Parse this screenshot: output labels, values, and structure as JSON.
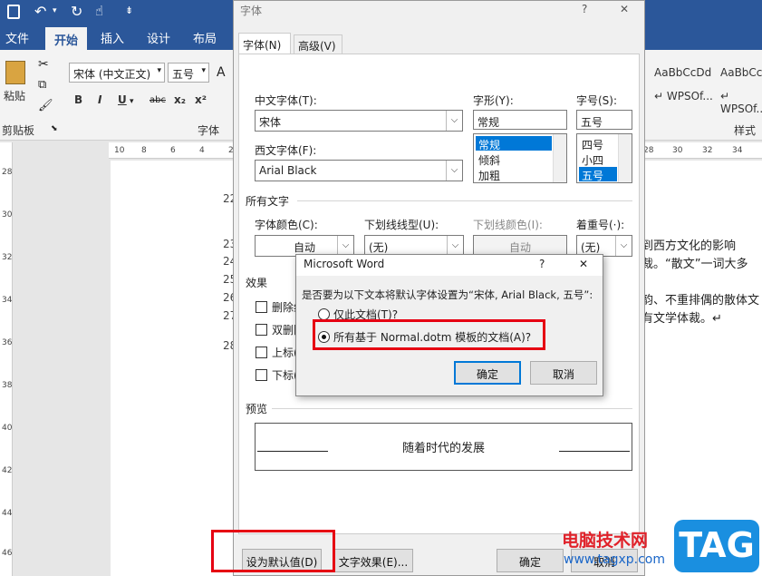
{
  "ribbon": {
    "tabs": [
      "文件",
      "开始",
      "插入",
      "设计",
      "布局"
    ],
    "active_tab": "开始",
    "paste_label": "粘贴",
    "clipboard_label": "剪贴板",
    "font_group_label": "字体",
    "styles_group_label": "样式",
    "font_name": "宋体 (中文正文)",
    "font_size": "五号",
    "style1_sample": "AaBbCcDd",
    "style1_name": "↵ WPSOf...",
    "style2_sample": "AaBbCcDd",
    "style2_name": "↵ WPSOf..."
  },
  "rulers": {
    "h_left": [
      "10",
      "8",
      "6",
      "4",
      "2"
    ],
    "h_right": [
      "28",
      "30",
      "32",
      "34"
    ],
    "v": [
      "28",
      "30",
      "32",
      "34",
      "36",
      "38",
      "40",
      "42",
      "44",
      "46"
    ]
  },
  "document": {
    "line_numbers": [
      "22",
      "23",
      "24",
      "25",
      "26",
      "27",
      "28"
    ],
    "right_lines": [
      "到西方文化的影响",
      "裁。“散文”一词大多",
      "韵、不重排偶的散体文",
      "有文学体裁。↵"
    ]
  },
  "font_dialog": {
    "title": "字体",
    "help": "?",
    "close": "✕",
    "tab_font": "字体(N)",
    "tab_advanced": "高级(V)",
    "cn_font_label": "中文字体(T):",
    "cn_font_value": "宋体",
    "style_label": "字形(Y):",
    "style_value": "常规",
    "style_options": [
      "常规",
      "倾斜",
      "加粗"
    ],
    "size_label": "字号(S):",
    "size_value": "五号",
    "size_options": [
      "四号",
      "小四",
      "五号"
    ],
    "west_font_label": "西文字体(F):",
    "west_font_value": "Arial Black",
    "all_text_label": "所有文字",
    "font_color_label": "字体颜色(C):",
    "font_color_value": "自动",
    "underline_label": "下划线线型(U):",
    "underline_value": "(无)",
    "underline_color_label": "下划线颜色(I):",
    "underline_color_value": "自动",
    "emphasis_label": "着重号(·):",
    "emphasis_value": "(无)",
    "effects_label": "效果",
    "effects": [
      "删除线",
      "双删除",
      "上标(",
      "下标("
    ],
    "preview_label": "预览",
    "preview_text": "随着时代的发展",
    "set_default_button": "设为默认值(D)",
    "text_effects_button": "文字效果(E)...",
    "ok_button": "确定",
    "cancel_button": "取消"
  },
  "message_box": {
    "title": "Microsoft Word",
    "help": "?",
    "close": "✕",
    "question": "是否要为以下文本将默认字体设置为“宋体, Arial Black, 五号”:",
    "option1": "仅此文档(T)?",
    "option2": "所有基于 Normal.dotm 模板的文档(A)?",
    "selected_option": 2,
    "ok_button": "确定",
    "cancel_button": "取消"
  },
  "watermark": {
    "text": "电脑技术网",
    "url": "www.tagxp.com",
    "tag": "TAG"
  },
  "colors": {
    "ribbon_blue": "#2b579a",
    "highlight_red": "#e60012",
    "selection_blue": "#0078d7"
  }
}
